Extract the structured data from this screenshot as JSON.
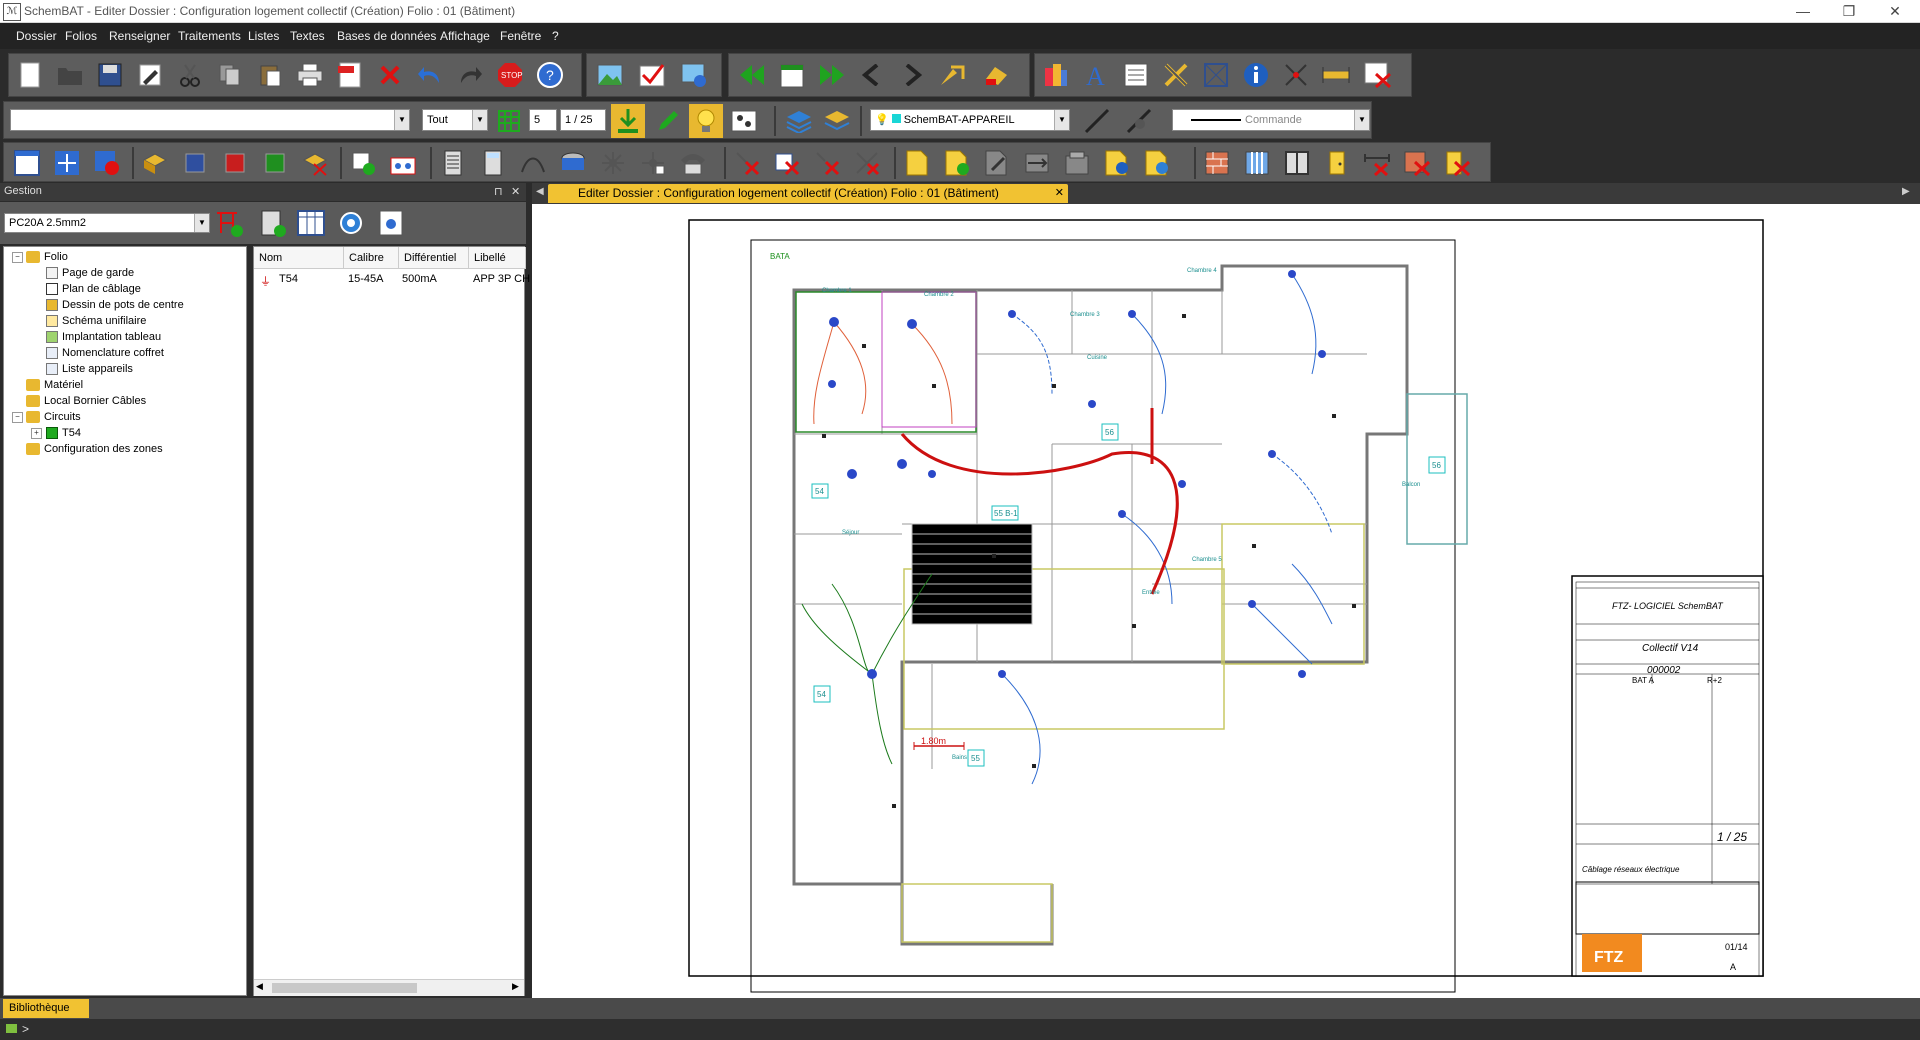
{
  "window": {
    "title": "SchemBAT - Editer  Dossier : Configuration logement collectif  (Création)  Folio : 01  (Bâtiment)",
    "minimize": "—",
    "maximize": "❐",
    "close": "✕"
  },
  "menu": [
    "Dossier",
    "Folios",
    "Renseigner",
    "Traitements",
    "Listes",
    "Textes",
    "Bases de données",
    "Affichage",
    "Fenêtre",
    "?"
  ],
  "toolbar2": {
    "combo_value": "",
    "filter": "Tout",
    "page_value": "5",
    "page_of": "1 / 25",
    "layer": "SchemBAT-APPAREIL",
    "command_placeholder": "Commande"
  },
  "gestion": {
    "title": "Gestion",
    "pin": "⊓",
    "close": "✕",
    "combo": "PC20A 2.5mm2"
  },
  "tree": [
    {
      "label": "Folio",
      "level": 0,
      "type": "folder",
      "expanded": true
    },
    {
      "label": "Page de garde",
      "level": 1,
      "type": "page"
    },
    {
      "label": "Plan de câblage",
      "level": 1,
      "type": "page"
    },
    {
      "label": "Dessin de pots de centre",
      "level": 1,
      "type": "page"
    },
    {
      "label": "Schéma unifilaire",
      "level": 1,
      "type": "page"
    },
    {
      "label": "Implantation tableau",
      "level": 1,
      "type": "page"
    },
    {
      "label": "Nomenclature coffret",
      "level": 1,
      "type": "page"
    },
    {
      "label": "Liste appareils",
      "level": 1,
      "type": "page"
    },
    {
      "label": "Matériel",
      "level": 0,
      "type": "folder"
    },
    {
      "label": "Local Bornier Câbles",
      "level": 0,
      "type": "folder"
    },
    {
      "label": "Circuits",
      "level": 0,
      "type": "folder",
      "expanded": true
    },
    {
      "label": "T54",
      "level": 1,
      "type": "circuit",
      "expandable": true
    },
    {
      "label": "Configuration des zones",
      "level": 0,
      "type": "folder"
    }
  ],
  "list": {
    "columns": [
      "Nom",
      "Calibre",
      "Différentiel",
      "Libellé"
    ],
    "rows": [
      [
        "T54",
        "15-45A",
        "500mA",
        "APP 3P CH"
      ]
    ]
  },
  "document_tab": {
    "label": "Editer  Dossier : Configuration logement collectif  (Création)  Folio : 01  (Bâtiment)",
    "close": "✕"
  },
  "plan": {
    "corner_label": "BATA",
    "zones": [
      "54",
      "54",
      "55",
      "56",
      "55 B-1",
      "56"
    ],
    "dimension": "1.80m",
    "rooms": [
      "Chambre 1",
      "Chambre 2",
      "Chambre 3",
      "Chambre 4",
      "Chambre 5",
      "Séjour",
      "Cuisine",
      "Balcon",
      "Bains",
      "Entrée"
    ]
  },
  "title_block": {
    "company": "FTZ- LOGICIEL SchemBAT",
    "project": "Collectif V14",
    "number": "000002",
    "building": "BAT A",
    "level": "R+2",
    "page": "1 / 25",
    "subject": "Câblage réseaux électrique",
    "date": "01/14",
    "index": "A",
    "logo": "FTZ"
  },
  "bottom": {
    "library_tab": "Bibliothèque"
  },
  "status": {
    "prompt": ">"
  }
}
